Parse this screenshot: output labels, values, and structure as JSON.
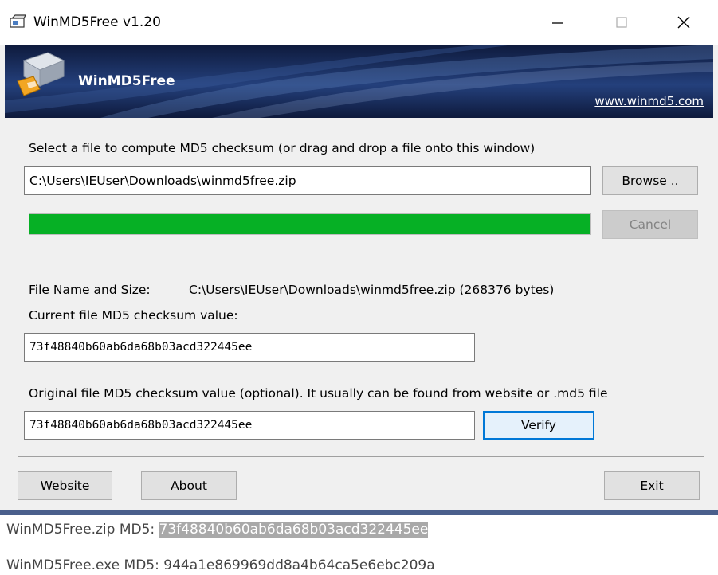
{
  "window": {
    "title": "WinMD5Free v1.20",
    "controls": {
      "minimize": "—",
      "maximize": "☐",
      "close": "✕"
    }
  },
  "banner": {
    "app_name": "WinMD5Free",
    "website_link": "www.winmd5.com"
  },
  "select_file": {
    "instruction": "Select a file to compute MD5 checksum (or drag and drop a file onto this window)",
    "path": "C:\\Users\\IEUser\\Downloads\\winmd5free.zip",
    "browse_label": "Browse ..",
    "cancel_label": "Cancel",
    "progress": 1.0,
    "progress_color": "#06b025"
  },
  "file_info": {
    "name_size_label": "File Name and Size:",
    "name_size_value": "C:\\Users\\IEUser\\Downloads\\winmd5free.zip (268376 bytes)",
    "current_label": "Current file MD5 checksum value:",
    "current_value": "73f48840b60ab6da68b03acd322445ee",
    "original_label": "Original file MD5 checksum value (optional). It usually can be found from website or .md5 file",
    "original_value": "73f48840b60ab6da68b03acd322445ee",
    "verify_label": "Verify"
  },
  "footer": {
    "website_label": "Website",
    "about_label": "About",
    "exit_label": "Exit"
  },
  "below_window": {
    "zip_prefix": "WinMD5Free.zip MD5: ",
    "zip_hash": "73f48840b60ab6da68b03acd322445ee",
    "exe_line": "WinMD5Free.exe MD5: 944a1e869969dd8a4b64ca5e6ebc209a"
  },
  "colors": {
    "accent": "#0078d7",
    "banner_dark": "#0e1a3c",
    "selection": "#a9a9a9"
  }
}
